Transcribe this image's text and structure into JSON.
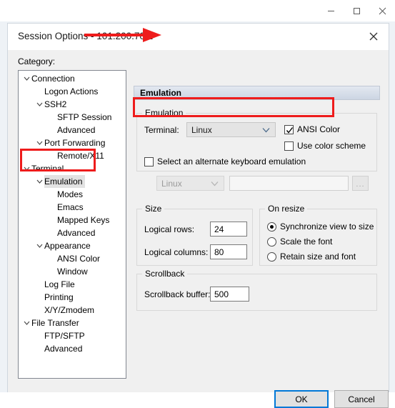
{
  "host_window": {
    "minimize_label": "minimize",
    "maximize_label": "maximize",
    "close_label": "close"
  },
  "dialog": {
    "title": "Session Options - 101.200.70.1",
    "close_label": "✕",
    "category_label": "Category:"
  },
  "tree": {
    "items": [
      {
        "label": "Connection",
        "indent": 0,
        "chevron": true,
        "selected": false
      },
      {
        "label": "Logon Actions",
        "indent": 1,
        "chevron": false,
        "selected": false
      },
      {
        "label": "SSH2",
        "indent": 1,
        "chevron": true,
        "selected": false
      },
      {
        "label": "SFTP Session",
        "indent": 2,
        "chevron": false,
        "selected": false
      },
      {
        "label": "Advanced",
        "indent": 2,
        "chevron": false,
        "selected": false
      },
      {
        "label": "Port Forwarding",
        "indent": 1,
        "chevron": true,
        "selected": false
      },
      {
        "label": "Remote/X11",
        "indent": 2,
        "chevron": false,
        "selected": false
      },
      {
        "label": "Terminal",
        "indent": 0,
        "chevron": true,
        "selected": false
      },
      {
        "label": "Emulation",
        "indent": 1,
        "chevron": true,
        "selected": true
      },
      {
        "label": "Modes",
        "indent": 2,
        "chevron": false,
        "selected": false
      },
      {
        "label": "Emacs",
        "indent": 2,
        "chevron": false,
        "selected": false
      },
      {
        "label": "Mapped Keys",
        "indent": 2,
        "chevron": false,
        "selected": false
      },
      {
        "label": "Advanced",
        "indent": 2,
        "chevron": false,
        "selected": false
      },
      {
        "label": "Appearance",
        "indent": 1,
        "chevron": true,
        "selected": false
      },
      {
        "label": "ANSI Color",
        "indent": 2,
        "chevron": false,
        "selected": false
      },
      {
        "label": "Window",
        "indent": 2,
        "chevron": false,
        "selected": false
      },
      {
        "label": "Log File",
        "indent": 1,
        "chevron": false,
        "selected": false
      },
      {
        "label": "Printing",
        "indent": 1,
        "chevron": false,
        "selected": false
      },
      {
        "label": "X/Y/Zmodem",
        "indent": 1,
        "chevron": false,
        "selected": false
      },
      {
        "label": "File Transfer",
        "indent": 0,
        "chevron": true,
        "selected": false
      },
      {
        "label": "FTP/SFTP",
        "indent": 1,
        "chevron": false,
        "selected": false
      },
      {
        "label": "Advanced",
        "indent": 1,
        "chevron": false,
        "selected": false
      }
    ]
  },
  "panel": {
    "header_title": "Emulation",
    "emulation_group": {
      "legend": "Emulation",
      "terminal_label": "Terminal:",
      "terminal_value": "Linux",
      "ansi_color_label": "ANSI Color",
      "ansi_color_checked": true,
      "use_color_scheme_label": "Use color scheme",
      "use_color_scheme_checked": false,
      "alternate_keyboard_label": "Select an alternate keyboard emulation",
      "alternate_keyboard_checked": false,
      "alternate_keyboard_value": "Linux",
      "alternate_keyboard_text": "",
      "browse_label": "..."
    },
    "size_group": {
      "legend": "Size",
      "rows_label": "Logical rows:",
      "rows_value": "24",
      "columns_label": "Logical columns:",
      "columns_value": "80"
    },
    "resize_group": {
      "legend": "On resize",
      "options": [
        {
          "label": "Synchronize view to size",
          "selected": true
        },
        {
          "label": "Scale the font",
          "selected": false
        },
        {
          "label": "Retain size and font",
          "selected": false
        }
      ]
    },
    "scrollback_group": {
      "legend": "Scrollback",
      "buffer_label": "Scrollback buffer:",
      "buffer_value": "500"
    }
  },
  "footer": {
    "ok_label": "OK",
    "cancel_label": "Cancel"
  },
  "annotations": {
    "accent_color": "#ee1c1c",
    "arrow_name": "red-arrow-pointing-right",
    "box_terminal_name": "red-box-terminal-row",
    "box_tree_name": "red-box-terminal-emulation-tree"
  }
}
